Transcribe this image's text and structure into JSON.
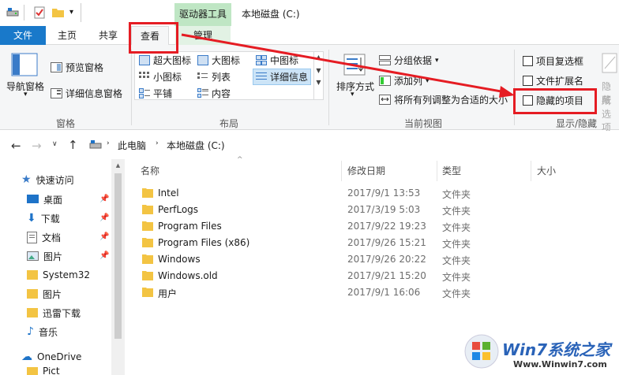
{
  "window": {
    "context_tab_label": "驱动器工具",
    "title": "本地磁盘 (C:)"
  },
  "tabs": {
    "file": "文件",
    "home": "主页",
    "share": "共享",
    "view": "查看",
    "manage": "管理"
  },
  "ribbon": {
    "panes": {
      "nav_pane": "导航窗格",
      "preview_pane": "预览窗格",
      "details_pane": "详细信息窗格",
      "group_label": "窗格"
    },
    "layout": {
      "extra_large_icons": "超大图标",
      "large_icons": "大图标",
      "medium_icons": "中图标",
      "small_icons": "小图标",
      "list": "列表",
      "details": "详细信息",
      "tiles": "平铺",
      "content": "内容",
      "group_label": "布局"
    },
    "current_view": {
      "sort_by": "排序方式",
      "group_by": "分组依据",
      "add_columns": "添加列",
      "size_all_columns": "将所有列调整为合适的大小",
      "group_label": "当前视图"
    },
    "show_hide": {
      "item_checkboxes": "项目复选框",
      "file_extensions": "文件扩展名",
      "hidden_items": "隐藏的项目",
      "hide_selected": "隐藏",
      "hide_selected_sub": "所选项",
      "group_label": "显示/隐藏"
    }
  },
  "address": {
    "crumb_root": "此电脑",
    "crumb_current": "本地磁盘 (C:)"
  },
  "nav": {
    "quick_access": "快速访问",
    "items": [
      "桌面",
      "下载",
      "文档",
      "图片",
      "System32",
      "图片",
      "迅雷下载",
      "音乐"
    ],
    "onedrive": "OneDrive",
    "partial": "Pict"
  },
  "columns": {
    "name": "名称",
    "modified": "修改日期",
    "type": "类型",
    "size": "大小"
  },
  "files": [
    {
      "name": "Intel",
      "date": "2017/9/1 13:53",
      "type": "文件夹"
    },
    {
      "name": "PerfLogs",
      "date": "2017/3/19 5:03",
      "type": "文件夹"
    },
    {
      "name": "Program Files",
      "date": "2017/9/22 19:23",
      "type": "文件夹"
    },
    {
      "name": "Program Files (x86)",
      "date": "2017/9/26 15:21",
      "type": "文件夹"
    },
    {
      "name": "Windows",
      "date": "2017/9/26 20:22",
      "type": "文件夹"
    },
    {
      "name": "Windows.old",
      "date": "2017/9/21 15:20",
      "type": "文件夹"
    },
    {
      "name": "用户",
      "date": "2017/9/1 16:06",
      "type": "文件夹"
    }
  ],
  "watermark": {
    "brand": "Win7系统之家",
    "url": "Www.Winwin7.com"
  },
  "colors": {
    "file_tab": "#1979ca",
    "context_green": "#bfe6c4",
    "annotation_red": "#e51c23",
    "folder_yellow": "#f3c443"
  }
}
